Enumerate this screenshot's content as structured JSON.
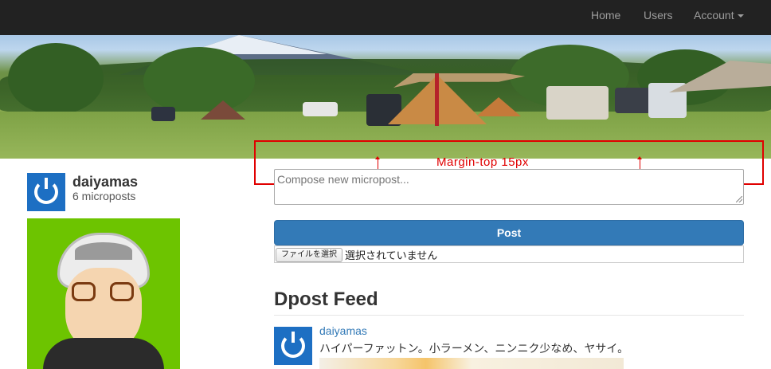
{
  "navbar": {
    "links": [
      {
        "label": "Home"
      },
      {
        "label": "Users"
      },
      {
        "label": "Account"
      }
    ]
  },
  "annotation": {
    "label": "Margin-top 15px",
    "color": "#e00000"
  },
  "sidebar": {
    "username": "daiyamas",
    "post_count": "6 microposts"
  },
  "composer": {
    "placeholder": "Compose new micropost...",
    "post_button_label": "Post",
    "file_button_label": "ファイルを選択",
    "file_status": "選択されていません"
  },
  "feed": {
    "title": "Dpost Feed",
    "items": [
      {
        "user": "daiyamas",
        "content": "ハイパーファットン。小ラーメン、ニンニク少なめ、ヤサイ。"
      }
    ]
  },
  "colors": {
    "navbar_bg": "#222222",
    "brand_blue": "#337ab7",
    "avatar_blue": "#1d6fc3",
    "profile_green": "#6dc400"
  }
}
